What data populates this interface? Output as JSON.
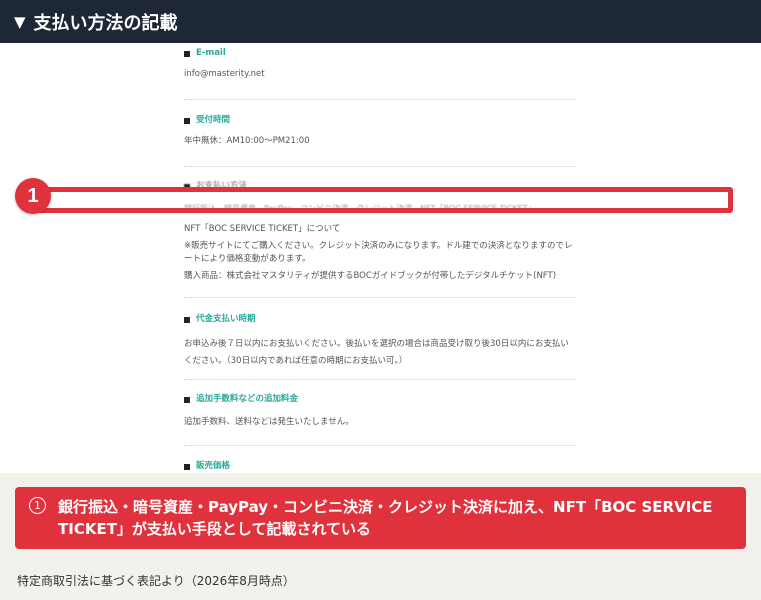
{
  "header": {
    "title": "支払い方法の記載"
  },
  "document": {
    "email": {
      "title": "E-mail",
      "value": "info@masterity.net"
    },
    "hours": {
      "title": "受付時間",
      "value": "年中無休：AM10:00〜PM21:00"
    },
    "payment": {
      "title": "お支払い方法",
      "methods": "銀行振込、暗号資産、PayPay、コンビニ決済、クレジット決済、NFT「BOC SERVICE TICKET」",
      "nft_heading": "NFT「BOC SERVICE TICKET」について",
      "note": "※販売サイトにてご購入ください。クレジット決済のみになります。ドル建での決済となりますのでレートにより価格変動があります。",
      "product": "購入商品：株式会社マスタリティが提供するBOCガイドブックが付帯したデジタルチケット(NFT)"
    },
    "timing": {
      "title": "代金支払い時期",
      "value": "お申込み後７日以内にお支払いください。後払いを選択の場合は商品受け取り後30日以内にお支払いください。（30日以内であれば任意の時期にお支払い可。）"
    },
    "fees": {
      "title": "追加手数料などの追加料金",
      "value": "追加手数料、送料などは発生いたしません。"
    },
    "price": {
      "title": "販売価格"
    }
  },
  "marker": {
    "label": "1"
  },
  "callout": {
    "num": "1",
    "text": "銀行振込・暗号資産・PayPay・コンビニ決済・クレジット決済に加え、NFT「BOC SERVICE TICKET」が支払い手段として記載されている"
  },
  "source": "特定商取引法に基づく表記より（2026年8月時点）",
  "colors": {
    "header_bg": "#1e2737",
    "accent_red": "#e0323d",
    "section_title": "#2aa89a"
  }
}
